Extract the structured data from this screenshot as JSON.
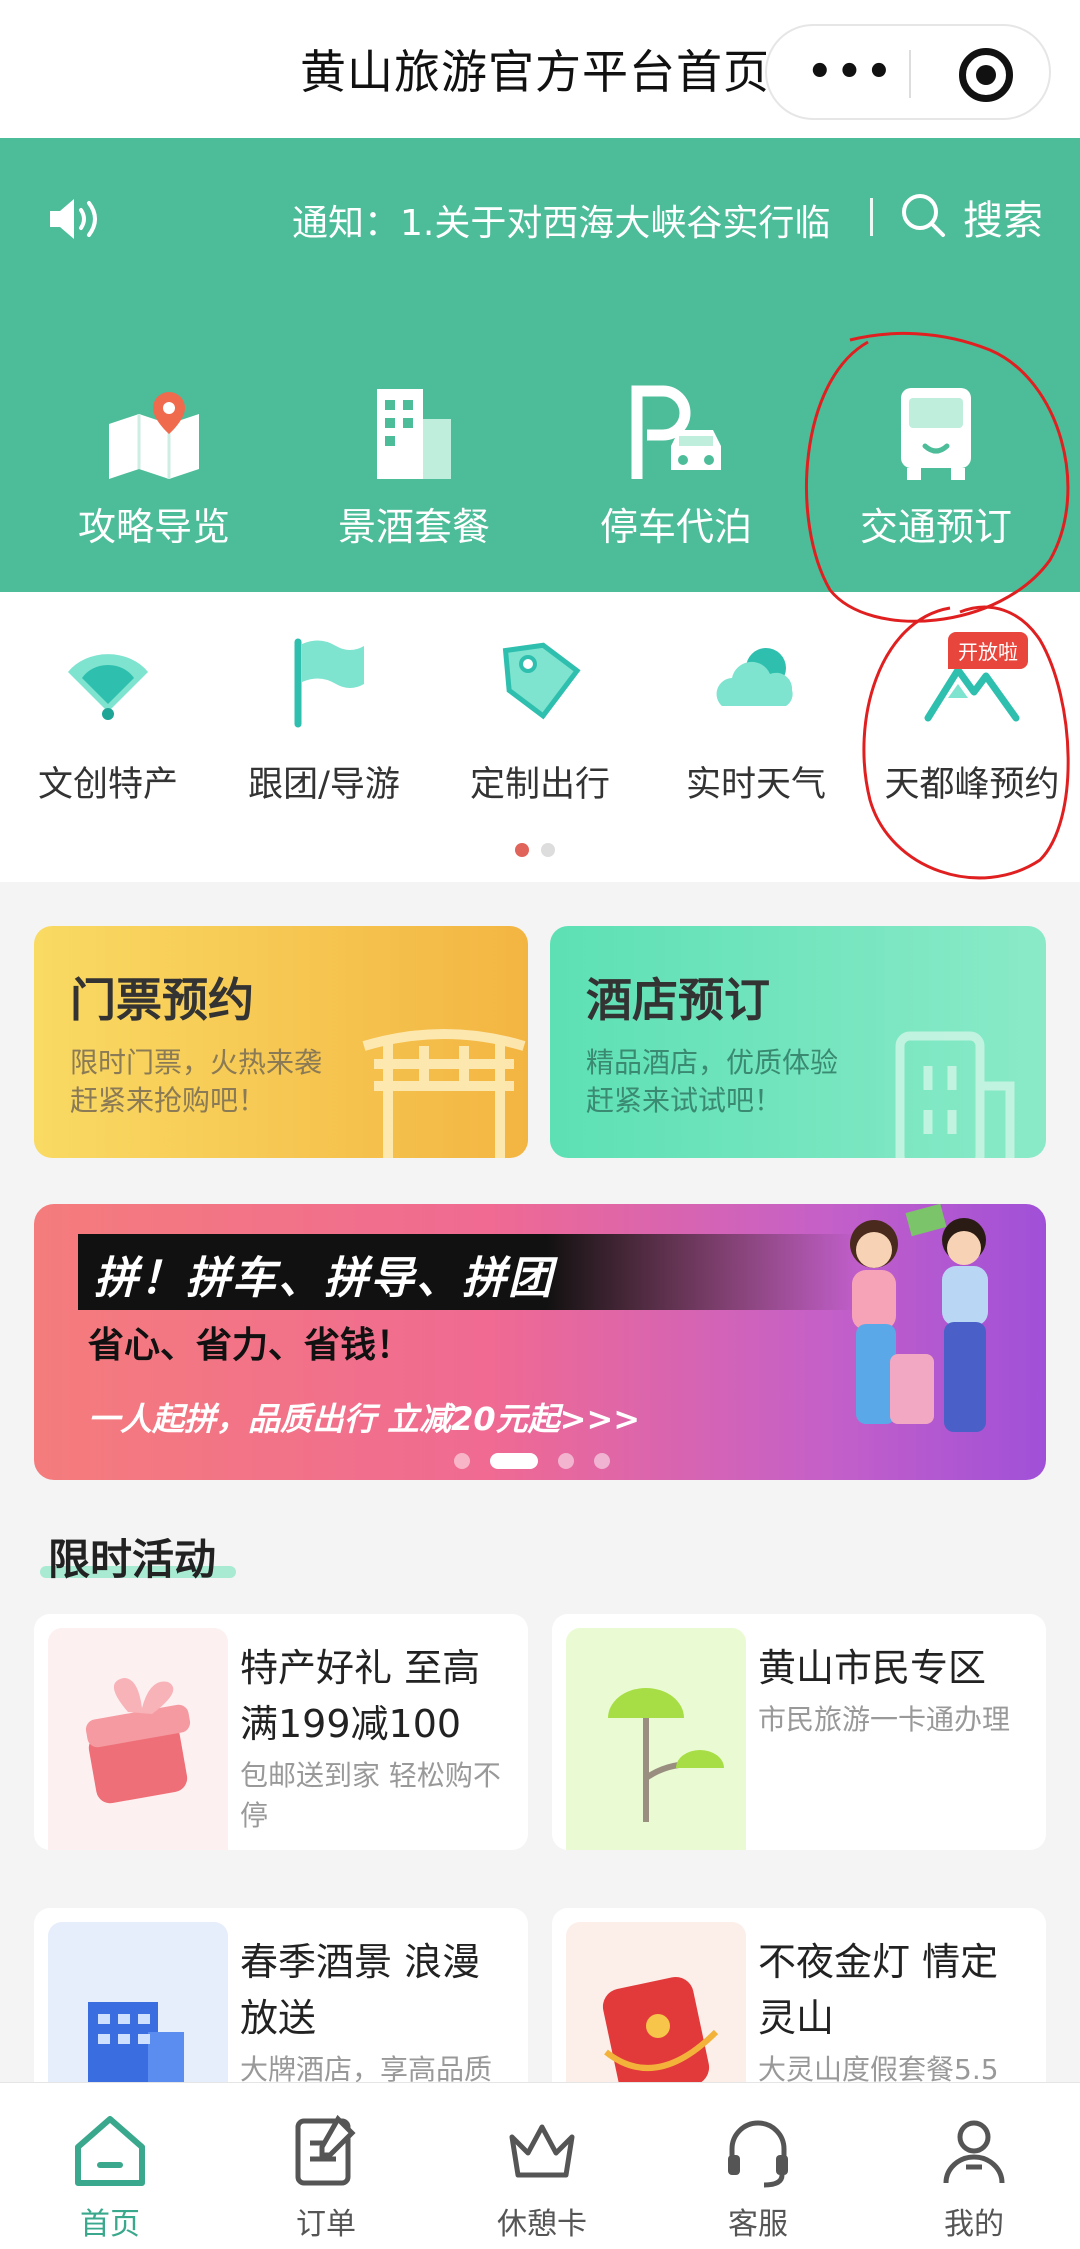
{
  "window": {
    "title": "黄山旅游官方平台首页"
  },
  "capsule": {
    "more_label": "•••"
  },
  "header": {
    "notice_text": "通知：1.关于对西海大峡谷实行临",
    "search_label": "搜索",
    "nav": [
      {
        "label": "攻略导览",
        "icon": "map-pin-icon"
      },
      {
        "label": "景酒套餐",
        "icon": "building-icon"
      },
      {
        "label": "停车代泊",
        "icon": "parking-icon"
      },
      {
        "label": "交通预订",
        "icon": "bus-icon"
      }
    ]
  },
  "subnav": {
    "items": [
      {
        "label": "文创特产",
        "icon": "fan-icon"
      },
      {
        "label": "跟团/导游",
        "icon": "flag-icon"
      },
      {
        "label": "定制出行",
        "icon": "tag-icon"
      },
      {
        "label": "实时天气",
        "icon": "cloud-icon"
      },
      {
        "label": "天都峰预约",
        "icon": "mountain-icon"
      }
    ],
    "badge": "开放啦"
  },
  "features": [
    {
      "title": "门票预约",
      "subtitle1": "限时门票，火热来袭",
      "subtitle2": "赶紧来抢购吧！"
    },
    {
      "title": "酒店预订",
      "subtitle1": "精品酒店，优质体验",
      "subtitle2": "赶紧来试试吧！"
    }
  ],
  "banner": {
    "title": "拼！拼车、拼导、拼团",
    "subtitle": "省心、省力、省钱！",
    "cta": "一人起拼，品质出行  立减20元起>>>"
  },
  "activities": {
    "section_title": "限时活动",
    "cards": [
      {
        "title": "特产好礼 至高满199减100",
        "subtitle": "包邮送到家 轻松购不停"
      },
      {
        "title": "黄山市民专区",
        "subtitle": "市民旅游一卡通办理"
      },
      {
        "title": "春季酒景 浪漫放送",
        "subtitle": "大牌酒店，享高品质"
      },
      {
        "title": "不夜金灯 情定灵山",
        "subtitle": "大灵山度假套餐5.5"
      }
    ]
  },
  "tabbar": {
    "tabs": [
      {
        "label": "首页",
        "active": true
      },
      {
        "label": "订单",
        "active": false
      },
      {
        "label": "休憩卡",
        "active": false
      },
      {
        "label": "客服",
        "active": false
      },
      {
        "label": "我的",
        "active": false
      }
    ]
  },
  "colors": {
    "brand_green": "#4cbc99",
    "accent_red": "#e8453c",
    "tab_active": "#3aa88c"
  }
}
